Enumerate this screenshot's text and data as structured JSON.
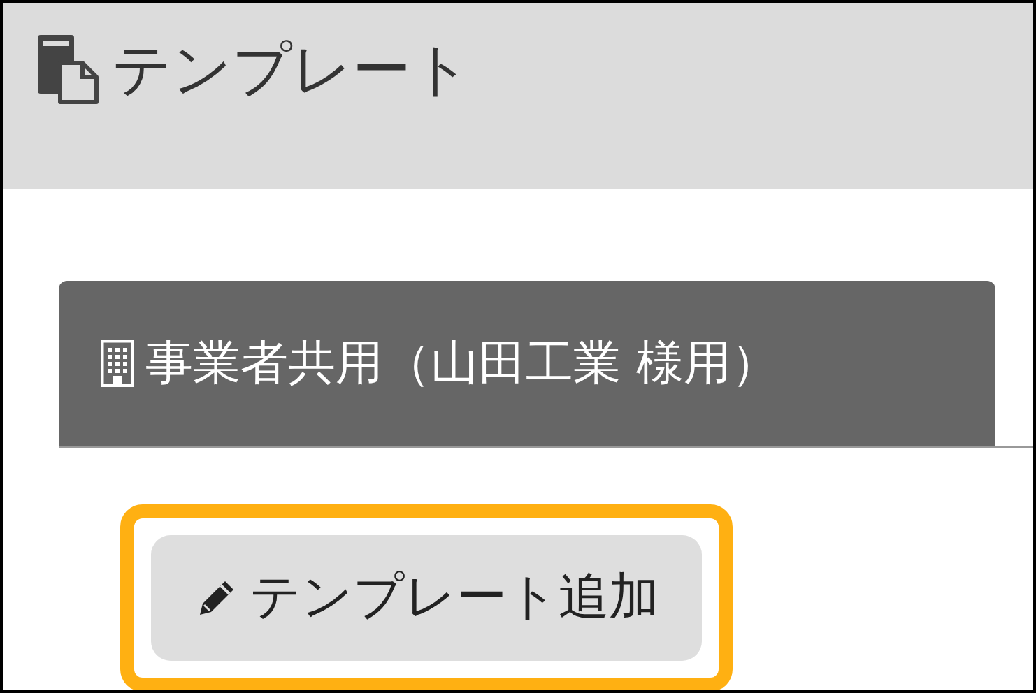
{
  "header": {
    "title": "テンプレート"
  },
  "tabs": [
    {
      "label": "事業者共用（山田工業 様用）",
      "selected": true
    }
  ],
  "add_button": {
    "label": "テンプレート追加",
    "highlighted": true
  }
}
